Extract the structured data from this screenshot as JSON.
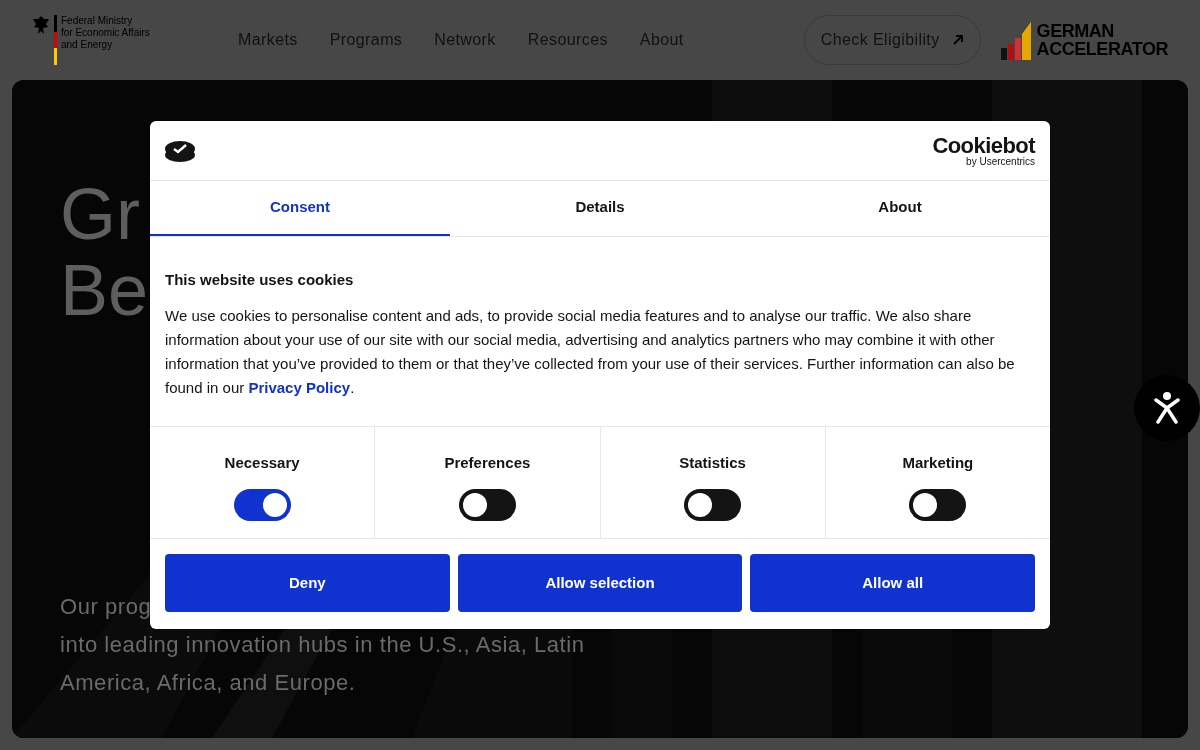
{
  "header": {
    "ministry_logo": [
      "Federal Ministry",
      "for Economic Affairs",
      "and Energy"
    ],
    "nav": [
      "Markets",
      "Programs",
      "Network",
      "Resources",
      "About"
    ],
    "cta": "Check Eligibility",
    "brand": [
      "GERMAN",
      "ACCELERATOR"
    ]
  },
  "hero": {
    "title_lines": [
      "Gr",
      "Be"
    ],
    "intro_lines": [
      "Our prog",
      "into leading innovation hubs in the U.S., Asia, Latin",
      "America, Africa, and Europe."
    ]
  },
  "cookie_dialog": {
    "brand": "Cookiebot",
    "brand_sub": "by Usercentrics",
    "tabs": [
      {
        "label": "Consent",
        "selected": true
      },
      {
        "label": "Details",
        "selected": false
      },
      {
        "label": "About",
        "selected": false
      }
    ],
    "heading": "This website uses cookies",
    "body": "We use cookies to personalise content and ads, to provide social media features and to analyse our traffic. We also share information about your use of our site with our social media, advertising and analytics partners who may combine it with other information that you’ve provided to them or that they’ve collected from your use of their services. Further information can also be found in our ",
    "link": "Privacy Policy",
    "body_end": ".",
    "categories": [
      {
        "label": "Necessary",
        "checked": true
      },
      {
        "label": "Preferences",
        "checked": false
      },
      {
        "label": "Statistics",
        "checked": false
      },
      {
        "label": "Marketing",
        "checked": false
      }
    ],
    "buttons": [
      "Deny",
      "Allow selection",
      "Allow all"
    ]
  }
}
